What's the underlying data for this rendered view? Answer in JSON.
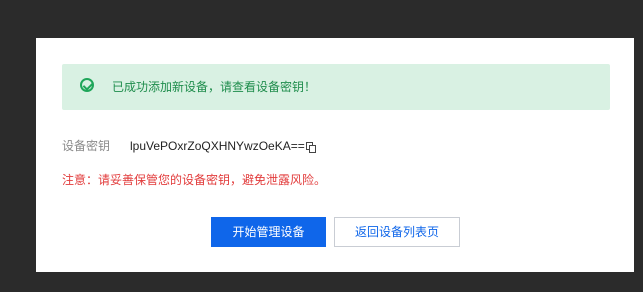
{
  "dialog": {
    "success_message": "已成功添加新设备，请查看设备密钥！",
    "key_label": "设备密钥",
    "key_value": "lpuVePOxrZoQXHNYwzOeKA==",
    "warning": "注意：请妥善保管您的设备密钥，避免泄露风险。",
    "primary_button": "开始管理设备",
    "secondary_button": "返回设备列表页"
  },
  "icons": {
    "success": "check-circle-icon",
    "copy": "copy-icon"
  },
  "colors": {
    "success_bg": "#d9f1e3",
    "success_text": "#1f8d4c",
    "warning_text": "#e23b3b",
    "primary": "#0f66ea"
  }
}
